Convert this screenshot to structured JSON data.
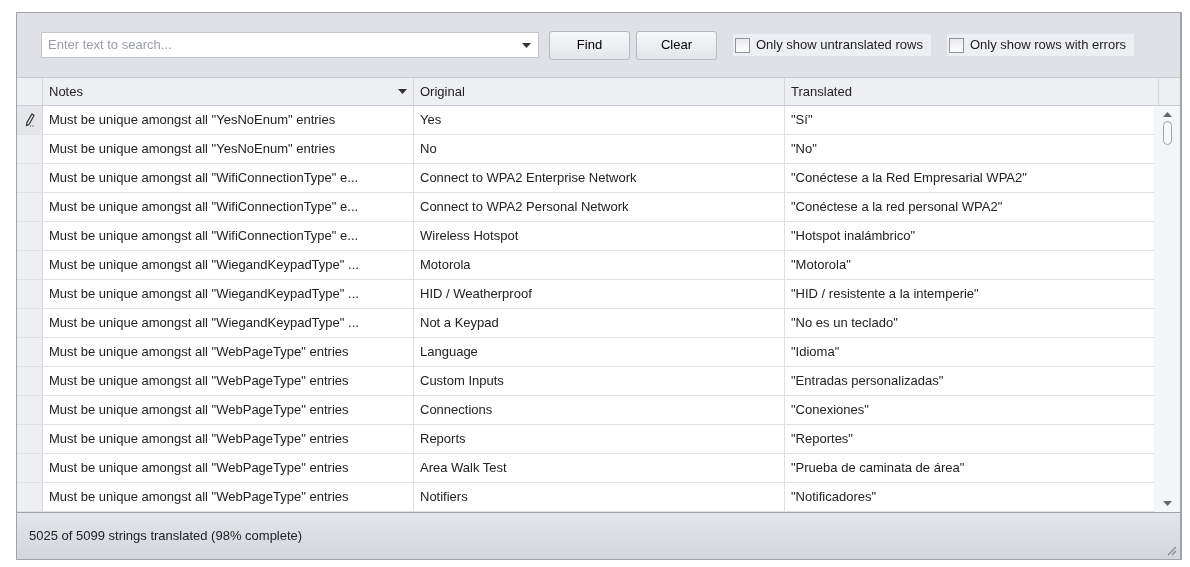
{
  "toolbar": {
    "search": {
      "placeholder": "Enter text to search..."
    },
    "buttons": [
      "Find",
      "Clear"
    ],
    "filters": [
      {
        "label": "Only show untranslated rows",
        "checked": false
      },
      {
        "label": "Only show rows with errors",
        "checked": false
      }
    ]
  },
  "table": {
    "columns": [
      "Notes",
      "Original",
      "Translated"
    ],
    "rows": [
      {
        "selected": true,
        "cells": [
          "Must be unique amongst all \"YesNoEnum\" entries",
          "Yes",
          "\"Sí\""
        ]
      },
      {
        "selected": false,
        "cells": [
          "Must be unique amongst all \"YesNoEnum\" entries",
          "No",
          "\"No\""
        ]
      },
      {
        "selected": false,
        "cells": [
          "Must be unique amongst all \"WifiConnectionType\" e...",
          "Connect to WPA2 Enterprise Network",
          "\"Conéctese a la Red Empresarial WPA2\""
        ]
      },
      {
        "selected": false,
        "cells": [
          "Must be unique amongst all \"WifiConnectionType\" e...",
          "Connect to WPA2 Personal Network",
          "\"Conéctese a la red personal WPA2\""
        ]
      },
      {
        "selected": false,
        "cells": [
          "Must be unique amongst all \"WifiConnectionType\" e...",
          "Wireless Hotspot",
          "\"Hotspot inalámbrico\""
        ]
      },
      {
        "selected": false,
        "cells": [
          "Must be unique amongst all \"WiegandKeypadType\" ...",
          "Motorola",
          "\"Motorola\""
        ]
      },
      {
        "selected": false,
        "cells": [
          "Must be unique amongst all \"WiegandKeypadType\" ...",
          "HID / Weatherproof",
          "\"HID / resistente a la intemperie\""
        ]
      },
      {
        "selected": false,
        "cells": [
          "Must be unique amongst all \"WiegandKeypadType\" ...",
          "Not a Keypad",
          "\"No es un teclado\""
        ]
      },
      {
        "selected": false,
        "cells": [
          "Must be unique amongst all \"WebPageType\" entries",
          "Language",
          "\"Idioma\""
        ]
      },
      {
        "selected": false,
        "cells": [
          "Must be unique amongst all \"WebPageType\" entries",
          "Custom Inputs",
          "\"Entradas personalizadas\""
        ]
      },
      {
        "selected": false,
        "cells": [
          "Must be unique amongst all \"WebPageType\" entries",
          "Connections",
          "\"Conexiones\""
        ]
      },
      {
        "selected": false,
        "cells": [
          "Must be unique amongst all \"WebPageType\" entries",
          "Reports",
          "\"Reportes\""
        ]
      },
      {
        "selected": false,
        "cells": [
          "Must be unique amongst all \"WebPageType\" entries",
          "Area Walk Test",
          "\"Prueba de caminata de área\""
        ]
      },
      {
        "selected": false,
        "cells": [
          "Must be unique amongst all \"WebPageType\" entries",
          "Notifiers",
          "\"Notificadores\""
        ]
      }
    ]
  },
  "status_bar": "5025 of 5099 strings translated (98% complete)"
}
